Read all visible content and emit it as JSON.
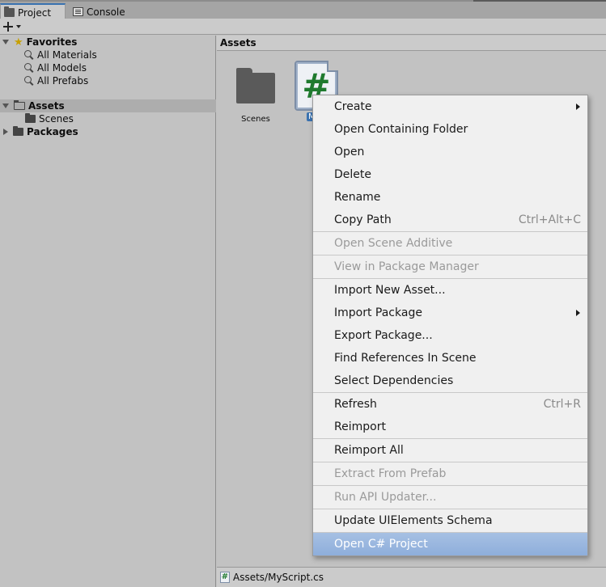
{
  "tabs": [
    {
      "label": "Project",
      "icon": "folder-icon",
      "active": true
    },
    {
      "label": "Console",
      "icon": "console-icon",
      "active": false
    }
  ],
  "tree": {
    "favorites": {
      "label": "Favorites",
      "items": [
        "All Materials",
        "All Models",
        "All Prefabs"
      ]
    },
    "assets": {
      "label": "Assets",
      "children": [
        "Scenes"
      ]
    },
    "packages": {
      "label": "Packages"
    }
  },
  "right_pane": {
    "header": "Assets",
    "items": [
      {
        "label": "Scenes",
        "type": "folder"
      },
      {
        "label": "MyScript",
        "type": "csharp-script",
        "visible_label": "MyS",
        "glyph": "#"
      }
    ]
  },
  "statusbar": {
    "path": "Assets/MyScript.cs",
    "glyph": "#"
  },
  "context_menu": {
    "items": [
      {
        "label": "Create",
        "submenu": true
      },
      {
        "label": "Open Containing Folder"
      },
      {
        "label": "Open"
      },
      {
        "label": "Delete"
      },
      {
        "label": "Rename"
      },
      {
        "label": "Copy Path",
        "shortcut": "Ctrl+Alt+C"
      },
      {
        "label": "Open Scene Additive",
        "disabled": true
      },
      {
        "label": "View in Package Manager",
        "disabled": true
      },
      {
        "label": "Import New Asset..."
      },
      {
        "label": "Import Package",
        "submenu": true
      },
      {
        "label": "Export Package..."
      },
      {
        "label": "Find References In Scene"
      },
      {
        "label": "Select Dependencies"
      },
      {
        "label": "Refresh",
        "shortcut": "Ctrl+R"
      },
      {
        "label": "Reimport"
      },
      {
        "label": "Reimport All"
      },
      {
        "label": "Extract From Prefab",
        "disabled": true
      },
      {
        "label": "Run API Updater...",
        "disabled": true
      },
      {
        "label": "Update UIElements Schema"
      },
      {
        "label": "Open C# Project",
        "highlighted": true
      }
    ]
  },
  "colors": {
    "selection_blue": "#3a72b0",
    "menu_highlight": "#8eaedb",
    "script_glyph_green": "#1f7a2e"
  }
}
